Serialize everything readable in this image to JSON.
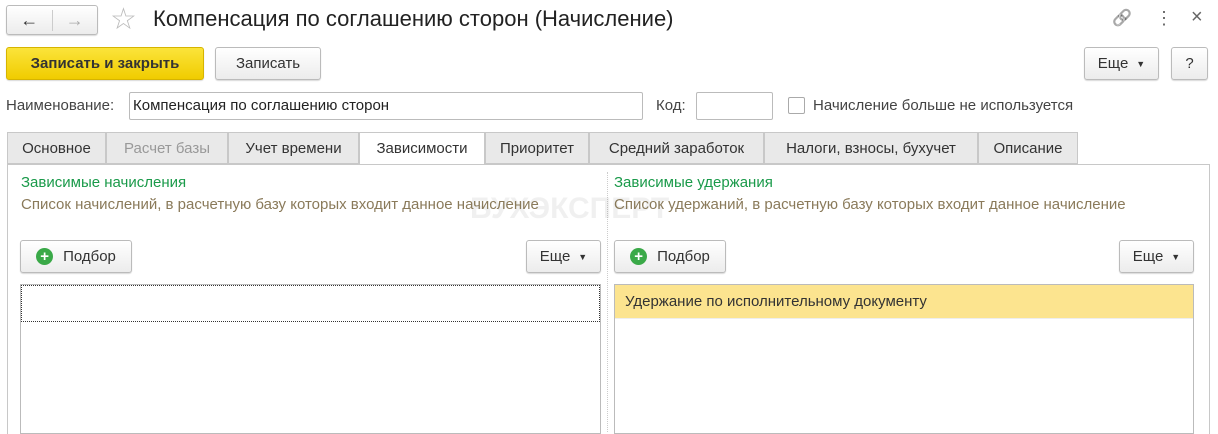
{
  "window": {
    "title": "Компенсация по соглашению сторон (Начисление)",
    "back": "←",
    "forward": "→",
    "star": "☆",
    "link": "🔗",
    "menu": "⋮",
    "close": "×"
  },
  "toolbar": {
    "save_close": "Записать и закрыть",
    "save": "Записать",
    "more": "Еще",
    "help": "?"
  },
  "form": {
    "name_label": "Наименование:",
    "name_value": "Компенсация по соглашению сторон",
    "code_label": "Код:",
    "code_value": "",
    "unused_label": "Начисление больше не используется"
  },
  "tabs": [
    "Основное",
    "Расчет базы",
    "Учет времени",
    "Зависимости",
    "Приоритет",
    "Средний заработок",
    "Налоги, взносы, бухучет",
    "Описание"
  ],
  "left": {
    "title": "Зависимые начисления",
    "desc": "Список начислений, в расчетную базу которых входит данное начисление",
    "pick": "Подбор",
    "more": "Еще"
  },
  "right": {
    "title": "Зависимые удержания",
    "desc": "Список удержаний, в расчетную базу которых входит данное начисление",
    "pick": "Подбор",
    "more": "Еще",
    "rows": [
      "Удержание по исполнительному документу"
    ]
  },
  "watermark": "БУХЭКСПЕРТ"
}
